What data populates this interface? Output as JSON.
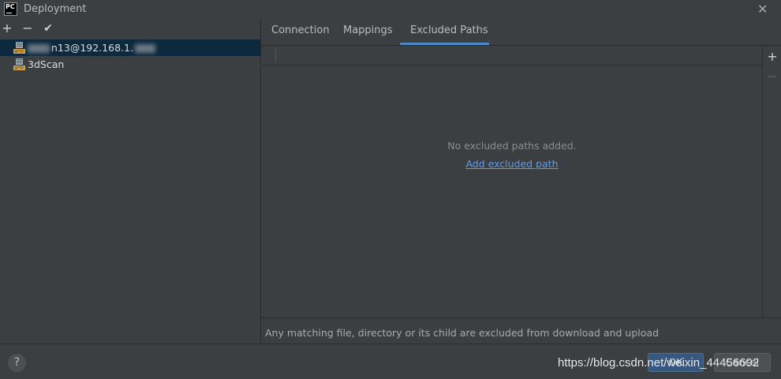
{
  "window": {
    "title": "Deployment",
    "icon_text": "PC"
  },
  "left_toolbar": {
    "add": "+",
    "remove": "−",
    "check": "✔"
  },
  "servers": [
    {
      "label": "n13@192.168.1.",
      "selected": true,
      "redacted_prefix": true,
      "redacted_suffix": true
    },
    {
      "label": "3dScan",
      "selected": false
    }
  ],
  "tabs": [
    {
      "label": "Connection",
      "active": false
    },
    {
      "label": "Mappings",
      "active": false
    },
    {
      "label": "Excluded Paths",
      "active": true
    }
  ],
  "excluded": {
    "empty_text": "No excluded paths added.",
    "add_link": "Add excluded path",
    "hint": "Any matching file, directory or its child are excluded from download and upload"
  },
  "right_toolbar": {
    "add": "+",
    "remove": "−"
  },
  "footer": {
    "help": "?",
    "ok": "OK",
    "cancel": "Cancel"
  },
  "watermark": "https://blog.csdn.net/weixin_44456692",
  "colors": {
    "background": "#3c3f41",
    "selection": "#0d293e",
    "accent": "#4a88c7",
    "link": "#589df6",
    "ok_button": "#365880"
  }
}
